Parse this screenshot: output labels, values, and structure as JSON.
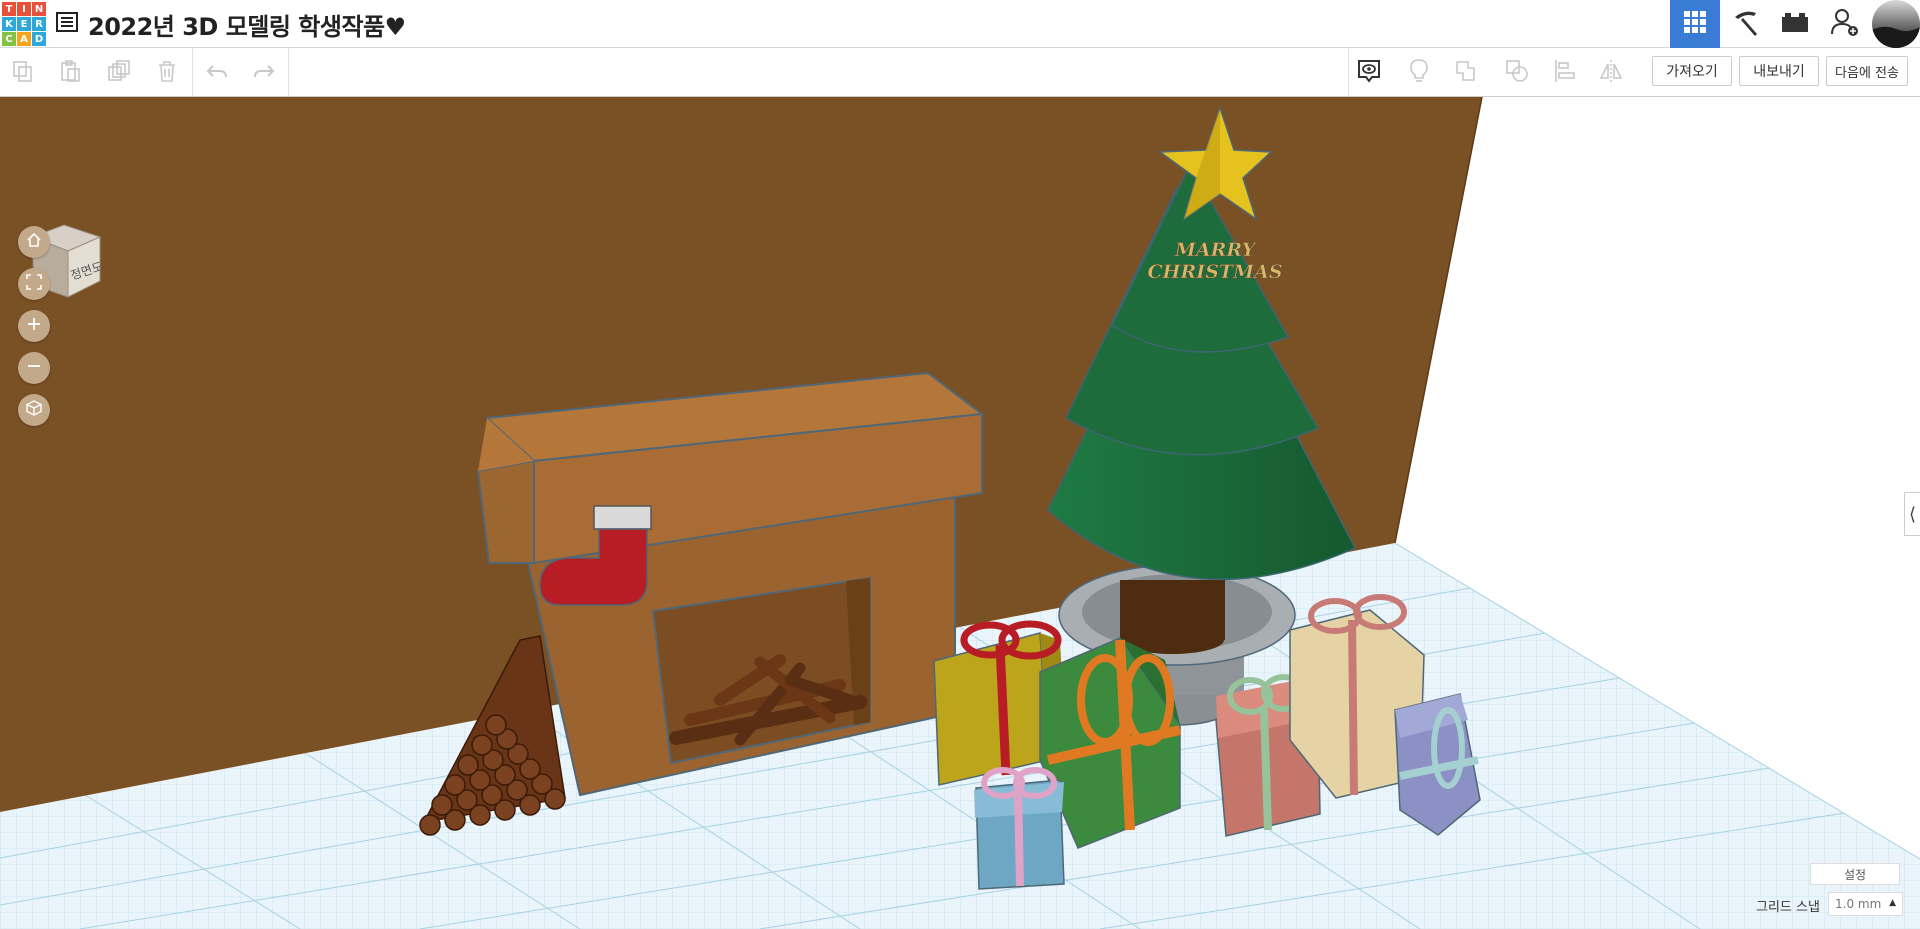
{
  "app": {
    "logo_letters": [
      "T",
      "I",
      "N",
      "K",
      "E",
      "R",
      "C",
      "A",
      "D"
    ],
    "logo_colors": [
      "#e8503a",
      "#e8503a",
      "#e8503a",
      "#2da8d8",
      "#2da8d8",
      "#2da8d8",
      "#82c341",
      "#f7a31b",
      "#2da8d8"
    ],
    "project_title": "2022년 3D 모델링 학생작품♥",
    "accent_color": "#3a7bd5"
  },
  "header": {
    "buttons": [
      {
        "name": "3d-design-view",
        "icon": "grid-icon",
        "active": true
      },
      {
        "name": "blocks-view",
        "icon": "pickaxe-icon",
        "active": false
      },
      {
        "name": "bricks-view",
        "icon": "brick-icon",
        "active": false
      },
      {
        "name": "add-user",
        "icon": "add-user-icon",
        "active": false
      }
    ]
  },
  "toolbar": {
    "import_label": "가져오기",
    "export_label": "내보내기",
    "send_to_label": "다음에 전송"
  },
  "viewcube": {
    "face_label": "정면도"
  },
  "scene": {
    "text_line1": "MARRY",
    "text_line2": "CHRISTMAS",
    "wall_color": "#7a5025",
    "tree_color": "#1e6b3c",
    "star_color": "#e6c21e"
  },
  "bottom": {
    "settings_label": "설정",
    "grid_snap_label": "그리드 스냅",
    "grid_snap_value": "1.0 mm"
  }
}
